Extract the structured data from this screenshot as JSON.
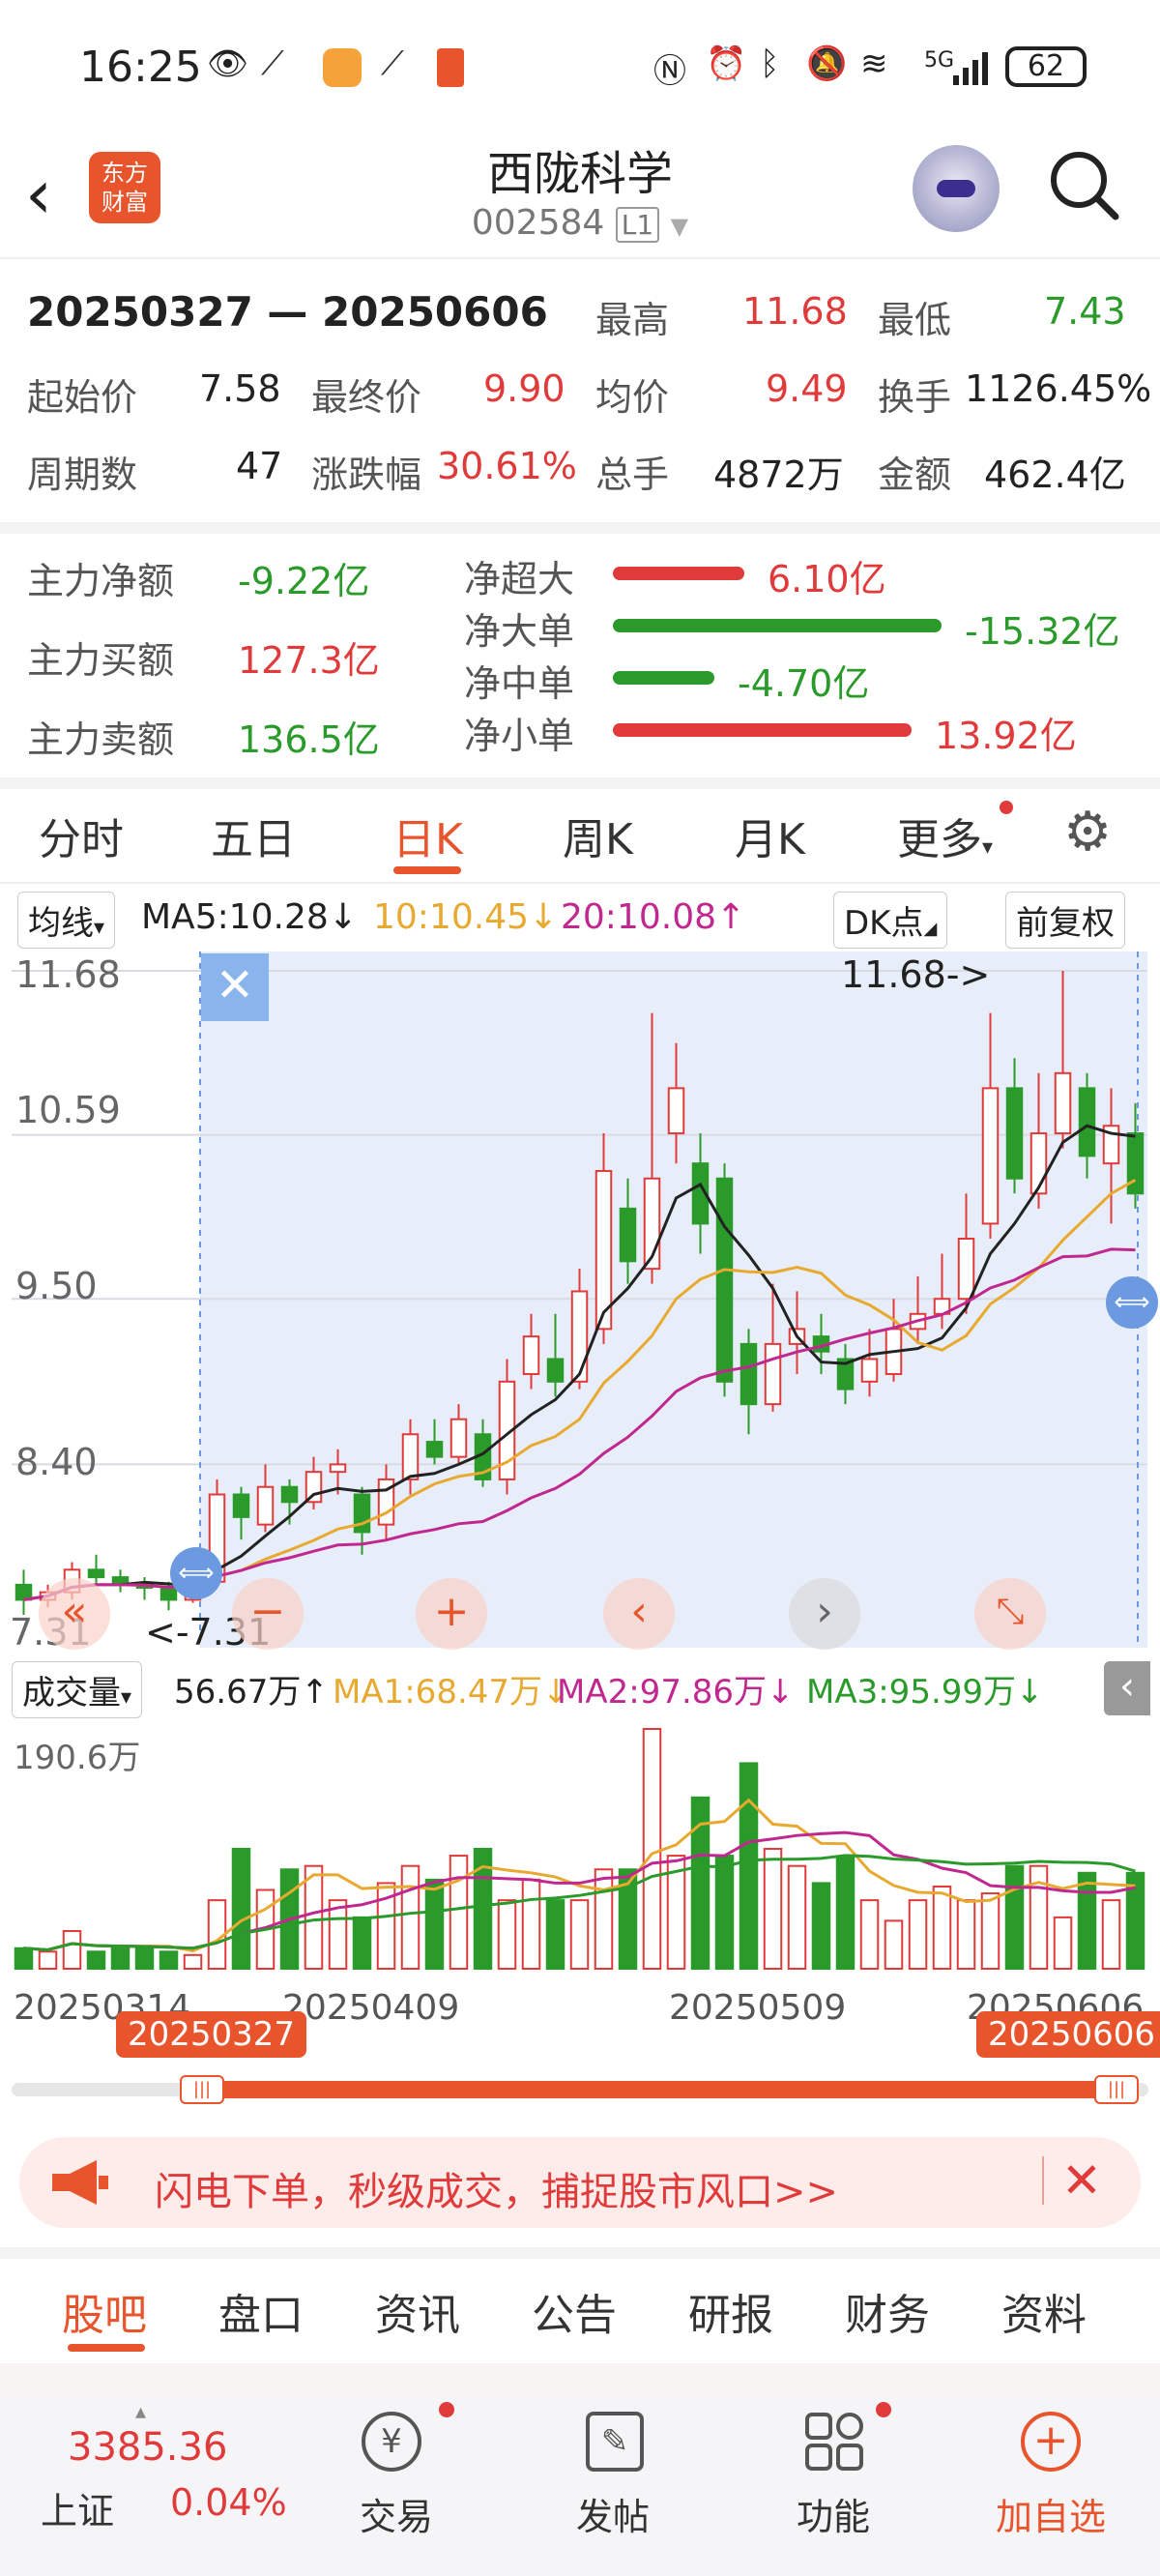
{
  "status_bar": {
    "time": "16:25",
    "network": "5G",
    "battery": "62"
  },
  "header": {
    "title": "西陇科学",
    "code": "002584",
    "level": "L1",
    "logo_line1": "东方",
    "logo_line2": "财富"
  },
  "summary": {
    "range": "20250327 — 20250606",
    "high_label": "最高",
    "high": "11.68",
    "low_label": "最低",
    "low": "7.43",
    "start_label": "起始价",
    "start": "7.58",
    "end_label": "最终价",
    "end": "9.90",
    "avg_label": "均价",
    "avg": "9.49",
    "turnover_label": "换手",
    "turnover": "1126.45%",
    "periods_label": "周期数",
    "periods": "47",
    "change_label": "涨跌幅",
    "change": "30.61%",
    "volume_label": "总手",
    "volume": "4872万",
    "amount_label": "金额",
    "amount": "462.4亿"
  },
  "fund_flow": {
    "main_net_label": "主力净额",
    "main_net": "-9.22亿",
    "main_buy_label": "主力买额",
    "main_buy": "127.3亿",
    "main_sell_label": "主力卖额",
    "main_sell": "136.5亿",
    "rows": [
      {
        "label": "净超大",
        "value": "6.10亿",
        "color": "#e03a3a",
        "share": 0.4
      },
      {
        "label": "净大单",
        "value": "-15.32亿",
        "color": "#2a9a2a",
        "share": 1.0
      },
      {
        "label": "净中单",
        "value": "-4.70亿",
        "color": "#2a9a2a",
        "share": 0.31
      },
      {
        "label": "净小单",
        "value": "13.92亿",
        "color": "#e03a3a",
        "share": 0.91
      }
    ]
  },
  "tabs": {
    "t1": "分时",
    "t2": "五日",
    "t3": "日K",
    "t4": "周K",
    "t5": "月K",
    "t6": "更多"
  },
  "ma_bar": {
    "indicator": "均线",
    "ma5": "MA5:10.28↓",
    "ma10": "10:10.45↓",
    "ma20": "20:10.08↑",
    "dk": "DK点",
    "adjust": "前复权"
  },
  "price_axis": {
    "p1": "11.68",
    "p2": "10.59",
    "p3": "9.50",
    "p4": "8.40",
    "p5": "7.31"
  },
  "annotations": {
    "high_marker": "11.68->",
    "low_marker": "<-7.31"
  },
  "volume_bar": {
    "label": "成交量",
    "current": "56.67万↑",
    "ma1": "MA1:68.47万↓",
    "ma2": "MA2:97.86万↓",
    "ma3": "MA3:95.99万↓",
    "axis_max": "190.6万"
  },
  "dates": {
    "d1": "20250314",
    "d2": "20250409",
    "d3": "20250509",
    "d4": "20250606"
  },
  "range_pills": {
    "start": "20250327",
    "end": "20250606"
  },
  "banner": {
    "text": "闪电下单，秒级成交，捕捉股市风口>>"
  },
  "bottom_tabs": {
    "b1": "股吧",
    "b2": "盘口",
    "b3": "资讯",
    "b4": "公告",
    "b5": "研报",
    "b6": "财务",
    "b7": "资料"
  },
  "nav": {
    "index_value": "3385.36",
    "index_name": "上证",
    "index_change": "0.04%",
    "trade": "交易",
    "post": "发帖",
    "features": "功能",
    "add": "加自选"
  },
  "colors": {
    "up": "#e03a3a",
    "down": "#2a9a2a",
    "accent": "#e8542c"
  },
  "chart_data": {
    "type": "candlestick",
    "ylim": [
      7.31,
      11.68
    ],
    "candles": [
      [
        7.6,
        7.5,
        7.7,
        7.4
      ],
      [
        7.5,
        7.55,
        7.6,
        7.45
      ],
      [
        7.55,
        7.7,
        7.75,
        7.5
      ],
      [
        7.7,
        7.65,
        7.8,
        7.6
      ],
      [
        7.65,
        7.6,
        7.7,
        7.55
      ],
      [
        7.6,
        7.58,
        7.65,
        7.5
      ],
      [
        7.58,
        7.5,
        7.62,
        7.43
      ],
      [
        7.5,
        7.62,
        7.7,
        7.48
      ],
      [
        7.62,
        8.2,
        8.3,
        7.6
      ],
      [
        8.2,
        8.05,
        8.25,
        7.9
      ],
      [
        8.0,
        8.25,
        8.4,
        7.95
      ],
      [
        8.25,
        8.15,
        8.3,
        8.0
      ],
      [
        8.15,
        8.35,
        8.45,
        8.1
      ],
      [
        8.35,
        8.4,
        8.5,
        8.2
      ],
      [
        8.2,
        7.95,
        8.25,
        7.8
      ],
      [
        8.0,
        8.3,
        8.4,
        7.9
      ],
      [
        8.3,
        8.6,
        8.7,
        8.2
      ],
      [
        8.55,
        8.45,
        8.7,
        8.4
      ],
      [
        8.45,
        8.7,
        8.8,
        8.4
      ],
      [
        8.6,
        8.3,
        8.7,
        8.25
      ],
      [
        8.3,
        8.95,
        9.1,
        8.2
      ],
      [
        9.0,
        9.25,
        9.4,
        8.9
      ],
      [
        9.1,
        8.95,
        9.4,
        8.85
      ],
      [
        8.95,
        9.55,
        9.7,
        8.9
      ],
      [
        9.3,
        10.35,
        10.6,
        9.2
      ],
      [
        10.1,
        9.75,
        10.3,
        9.6
      ],
      [
        9.7,
        10.3,
        11.4,
        9.6
      ],
      [
        10.6,
        10.9,
        11.2,
        10.4
      ],
      [
        10.4,
        10.0,
        10.6,
        9.8
      ],
      [
        10.3,
        8.95,
        10.4,
        8.85
      ],
      [
        9.2,
        8.8,
        9.3,
        8.6
      ],
      [
        8.8,
        9.2,
        9.6,
        8.75
      ],
      [
        9.2,
        9.3,
        9.55,
        9.0
      ],
      [
        9.25,
        9.15,
        9.4,
        9.0
      ],
      [
        9.1,
        8.9,
        9.2,
        8.8
      ],
      [
        8.95,
        9.1,
        9.3,
        8.85
      ],
      [
        9.0,
        9.3,
        9.5,
        8.95
      ],
      [
        9.3,
        9.4,
        9.65,
        9.2
      ],
      [
        9.4,
        9.5,
        9.8,
        9.3
      ],
      [
        9.5,
        9.9,
        10.2,
        9.4
      ],
      [
        10.0,
        10.9,
        11.4,
        9.9
      ],
      [
        10.9,
        10.3,
        11.1,
        10.2
      ],
      [
        10.2,
        10.6,
        11.0,
        10.1
      ],
      [
        10.6,
        11.0,
        11.68,
        10.5
      ],
      [
        10.9,
        10.45,
        11.0,
        10.3
      ],
      [
        10.4,
        10.65,
        10.9,
        10.0
      ],
      [
        10.6,
        10.2,
        10.8,
        10.1
      ]
    ],
    "volumes": [
      12,
      10,
      22,
      10,
      12,
      12,
      10,
      8,
      40,
      70,
      46,
      58,
      60,
      40,
      30,
      50,
      60,
      52,
      66,
      70,
      40,
      52,
      40,
      40,
      58,
      58,
      140,
      66,
      100,
      66,
      120,
      70,
      60,
      50,
      65,
      40,
      28,
      40,
      48,
      40,
      44,
      60,
      60,
      30,
      56,
      40,
      56
    ]
  }
}
